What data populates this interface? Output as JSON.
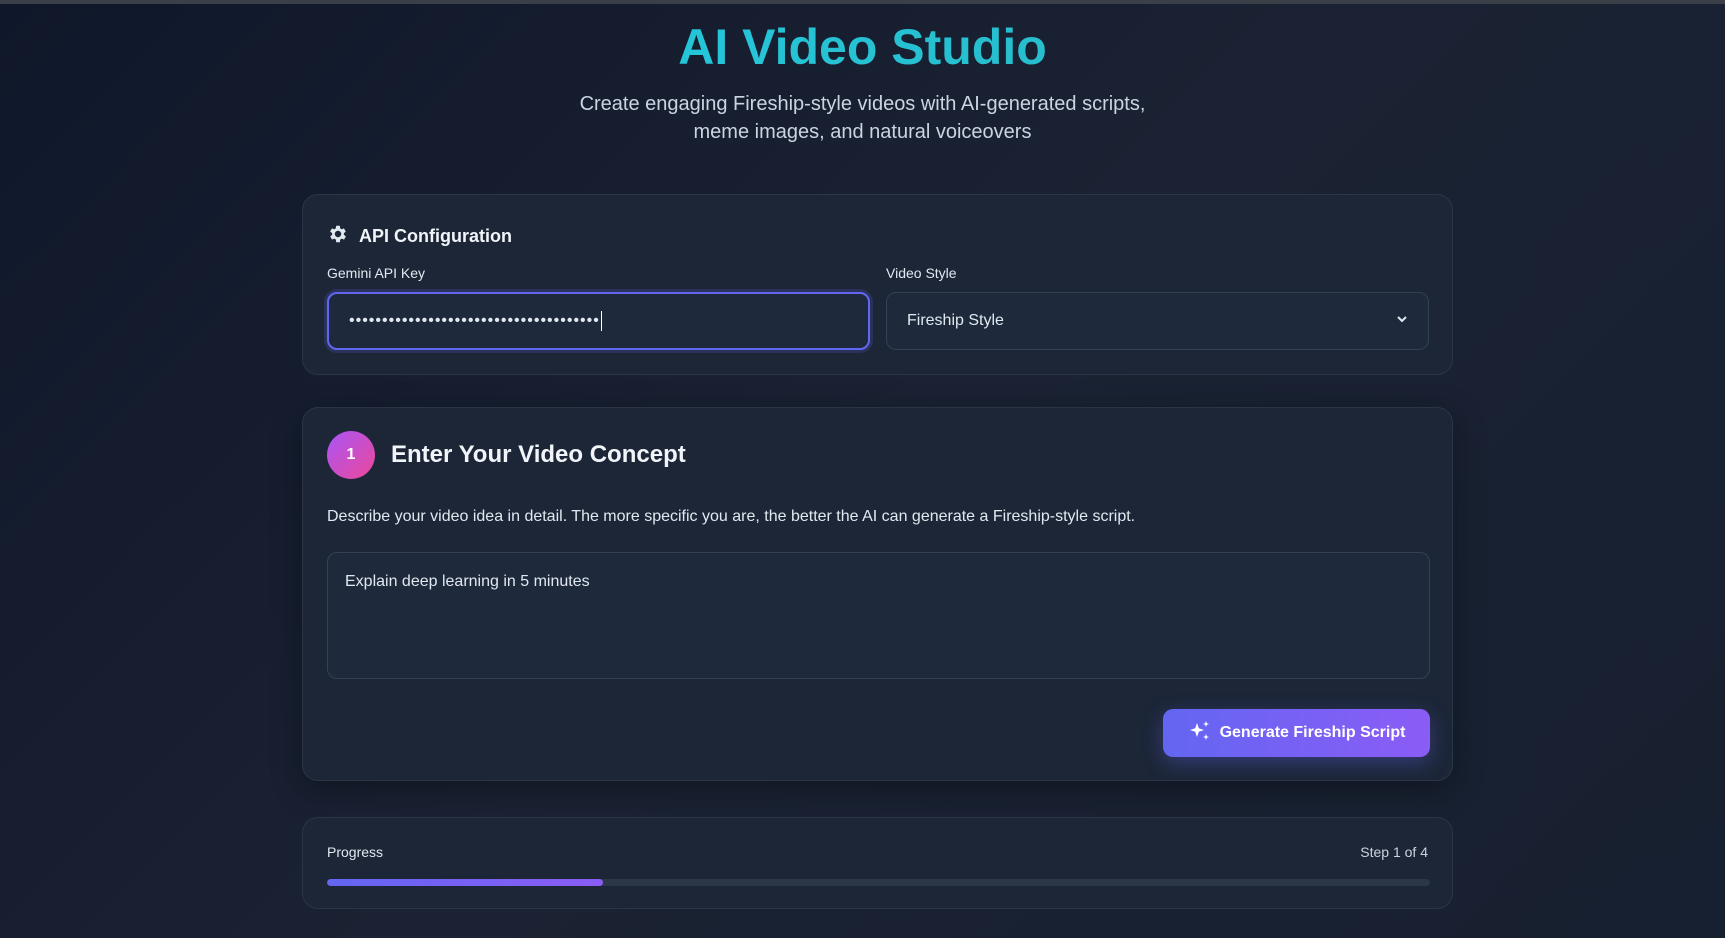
{
  "header": {
    "title": "AI Video Studio",
    "subtitle_line1": "Create engaging Fireship-style videos with AI-generated scripts,",
    "subtitle_line2": "meme images, and natural voiceovers"
  },
  "api_config": {
    "heading": "API Configuration",
    "icon": "gear-icon",
    "key_label": "Gemini API Key",
    "key_value": "••••••••••••••••••••••••••••••••••••••",
    "style_label": "Video Style",
    "style_value": "Fireship Style"
  },
  "step1": {
    "number": "1",
    "heading": "Enter Your Video Concept",
    "description": "Describe your video idea in detail. The more specific you are, the better the AI can generate a Fireship-style script.",
    "concept_value": "Explain deep learning in 5 minutes",
    "button_label": "Generate Fireship Script",
    "button_icon": "sparkles-icon"
  },
  "progress": {
    "label": "Progress",
    "step_text": "Step 1 of 4",
    "percent": 25
  },
  "colors": {
    "accent": "#6366f1",
    "accent2": "#8b5cf6",
    "title": "#22d3ee"
  }
}
